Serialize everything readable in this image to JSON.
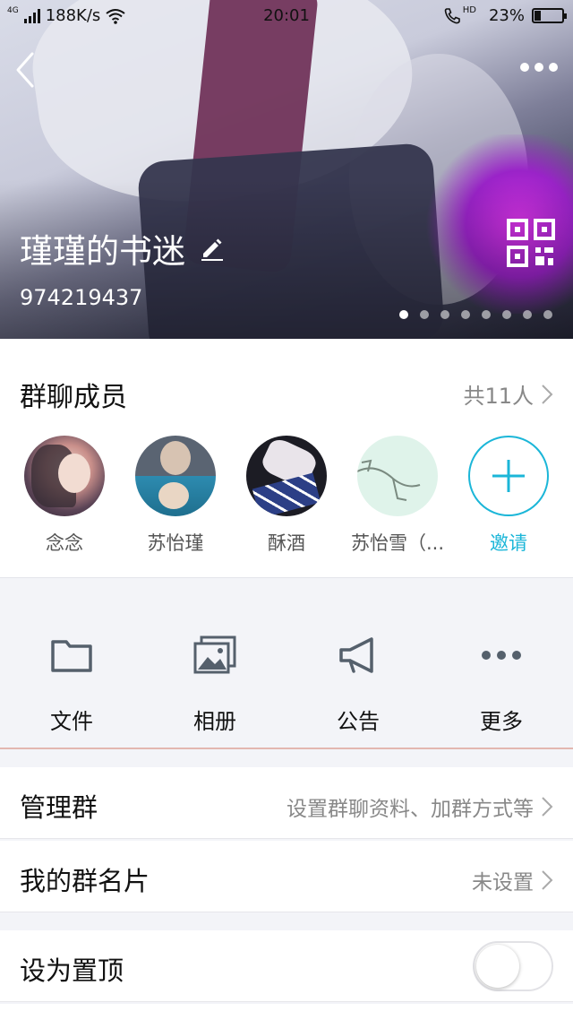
{
  "status_bar": {
    "network": "4G",
    "speed": "188K/s",
    "time": "20:01",
    "hd": "HD",
    "battery": "23%",
    "battery_level": 0.23
  },
  "header": {
    "group_name": "瑾瑾的书迷",
    "group_id": "974219437",
    "page_dots": 8,
    "active_dot": 0
  },
  "members": {
    "title": "群聊成员",
    "count": "共11人",
    "items": [
      {
        "name": "念念"
      },
      {
        "name": "苏怡瑾"
      },
      {
        "name": "酥酒"
      },
      {
        "name": "苏怡雪（..."
      }
    ],
    "invite_label": "邀请"
  },
  "actions": [
    {
      "label": "文件",
      "icon": "folder-icon"
    },
    {
      "label": "相册",
      "icon": "album-icon"
    },
    {
      "label": "公告",
      "icon": "megaphone-icon"
    },
    {
      "label": "更多",
      "icon": "more-dots-icon"
    }
  ],
  "settings": {
    "manage": {
      "label": "管理群",
      "value": "设置群聊资料、加群方式等"
    },
    "card": {
      "label": "我的群名片",
      "value": "未设置"
    },
    "pin": {
      "label": "设为置顶",
      "on": false
    }
  },
  "colors": {
    "accent": "#1bb6d8",
    "text": "#111111",
    "secondary": "#888888"
  }
}
